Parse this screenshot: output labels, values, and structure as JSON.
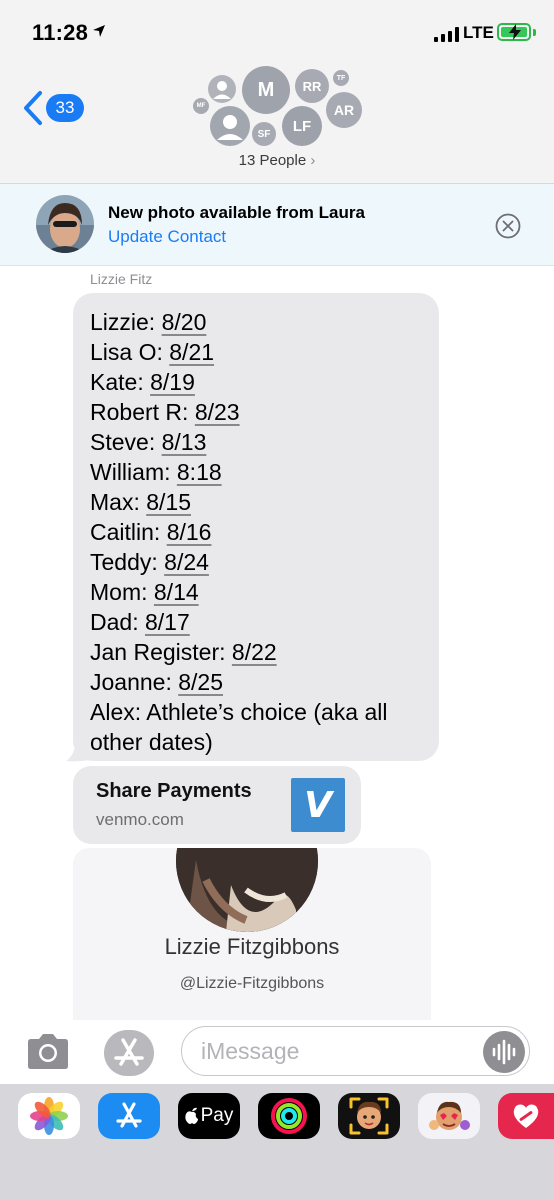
{
  "status_bar": {
    "time": "11:28",
    "carrier": "LTE"
  },
  "header": {
    "back_count": "33",
    "people_label": "13 People",
    "avatars": [
      "M",
      "RR",
      "TF",
      "MF",
      "AR",
      "SF",
      "LF"
    ]
  },
  "banner": {
    "title": "New photo available from Laura",
    "link": "Update Contact"
  },
  "conversation": {
    "sender": "Lizzie Fitz",
    "lines": [
      {
        "name": "Lizzie: ",
        "date": "8/20"
      },
      {
        "name": "Lisa O: ",
        "date": "8/21"
      },
      {
        "name": "Kate: ",
        "date": "8/19"
      },
      {
        "name": "Robert R: ",
        "date": "8/23"
      },
      {
        "name": "Steve: ",
        "date": "8/13"
      },
      {
        "name": "William: ",
        "date": "8:18"
      },
      {
        "name": "Max: ",
        "date": "8/15"
      },
      {
        "name": "Caitlin: ",
        "date": "8/16"
      },
      {
        "name": "Teddy: ",
        "date": "8/24"
      },
      {
        "name": "Mom: ",
        "date": "8/14"
      },
      {
        "name": "Dad: ",
        "date": "8/17"
      },
      {
        "name": "Jan Register: ",
        "date": "8/22"
      },
      {
        "name": "Joanne: ",
        "date": "8/25"
      }
    ],
    "last_line_1": "Alex: Athlete’s choice (aka all",
    "last_line_2": "other dates)",
    "link_card": {
      "title": "Share Payments",
      "domain": "venmo.com",
      "logo_letter": "V"
    },
    "profile_card": {
      "name": "Lizzie Fitzgibbons",
      "handle": "@Lizzie-Fitzgibbons"
    }
  },
  "input": {
    "placeholder": "iMessage"
  },
  "app_drawer": {
    "apps": [
      "photos-app",
      "app-store",
      "apple-pay",
      "fitness-activity",
      "memoji",
      "animoji-stickers",
      "image-playground"
    ],
    "apple_pay_label": "Pay"
  },
  "colors": {
    "accent": "#1a7cf5",
    "bubble": "#e9e9eb",
    "banner": "#eef8fc",
    "venmo": "#3d8ccf"
  }
}
